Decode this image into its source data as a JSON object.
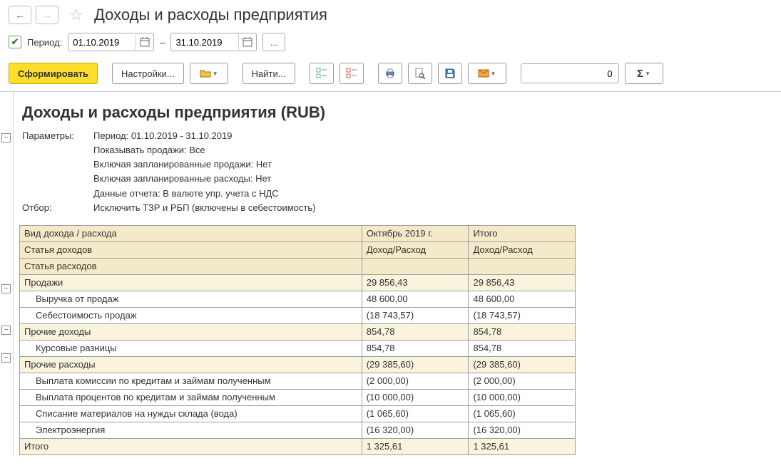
{
  "header": {
    "title": "Доходы и расходы предприятия"
  },
  "period": {
    "checkbox_label": "Период:",
    "date_from": "01.10.2019",
    "date_to": "31.10.2019",
    "dash": "–"
  },
  "toolbar": {
    "generate": "Сформировать",
    "settings": "Настройки...",
    "find": "Найти...",
    "num_value": "0"
  },
  "report": {
    "title": "Доходы и расходы предприятия (RUB)",
    "params_label": "Параметры:",
    "params_lines": [
      "Период: 01.10.2019 - 31.10.2019",
      "Показывать продажи: Все",
      "Включая запланированные продажи: Нет",
      "Включая запланированные расходы: Нет",
      "Данные отчета: В валюте упр. учета с НДС"
    ],
    "filter_label": "Отбор:",
    "filter_text": "Исключить ТЗР и РБП (включены в себестоимость)",
    "columns": {
      "kind": "Вид дохода / расхода",
      "income_art": "Статья доходов",
      "expense_art": "Статья расходов",
      "period_col": "Октябрь 2019 г.",
      "total_col": "Итого",
      "sub": "Доход/Расход"
    },
    "rows": [
      {
        "level": 0,
        "name": "Продажи",
        "v1": "29 856,43",
        "v2": "29 856,43"
      },
      {
        "level": 1,
        "name": "Выручка от продаж",
        "v1": "48 600,00",
        "v2": "48 600,00"
      },
      {
        "level": 1,
        "name": "Себестоимость продаж",
        "v1": "(18 743,57)",
        "v2": "(18 743,57)"
      },
      {
        "level": 0,
        "name": "Прочие доходы",
        "v1": "854,78",
        "v2": "854,78"
      },
      {
        "level": 1,
        "name": "Курсовые разницы",
        "v1": "854,78",
        "v2": "854,78"
      },
      {
        "level": 0,
        "name": "Прочие расходы",
        "v1": "(29 385,60)",
        "v2": "(29 385,60)"
      },
      {
        "level": 1,
        "name": "Выплата комиссии по кредитам и займам полученным",
        "v1": "(2 000,00)",
        "v2": "(2 000,00)"
      },
      {
        "level": 1,
        "name": "Выплата процентов по кредитам и займам полученным",
        "v1": "(10 000,00)",
        "v2": "(10 000,00)"
      },
      {
        "level": 1,
        "name": "Списание материалов на нужды склада (вода)",
        "v1": "(1 065,60)",
        "v2": "(1 065,60)"
      },
      {
        "level": 1,
        "name": "Электроэнергия",
        "v1": "(16 320,00)",
        "v2": "(16 320,00)"
      },
      {
        "level": 0,
        "name": "Итого",
        "v1": "1 325,61",
        "v2": "1 325,61"
      }
    ]
  }
}
